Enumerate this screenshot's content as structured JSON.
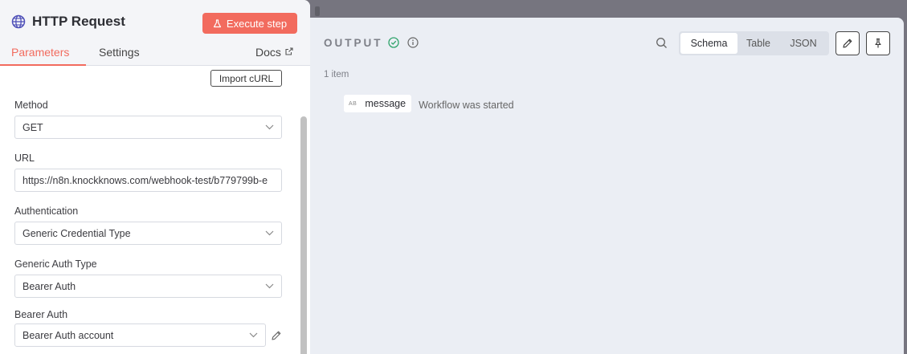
{
  "node": {
    "title": "HTTP Request",
    "execute_label": "Execute step",
    "tabs": {
      "parameters": "Parameters",
      "settings": "Settings",
      "docs": "Docs"
    }
  },
  "params": {
    "import_label": "Import cURL",
    "method": {
      "label": "Method",
      "value": "GET"
    },
    "url": {
      "label": "URL",
      "value": "https://n8n.knockknows.com/webhook-test/b779799b-e"
    },
    "authentication": {
      "label": "Authentication",
      "value": "Generic Credential Type"
    },
    "generic_auth_type": {
      "label": "Generic Auth Type",
      "value": "Bearer Auth"
    },
    "bearer_auth": {
      "label": "Bearer Auth",
      "value": "Bearer Auth account"
    }
  },
  "output": {
    "title": "OUTPUT",
    "views": {
      "schema": "Schema",
      "table": "Table",
      "json": "JSON"
    },
    "item_count": "1 item",
    "rows": [
      {
        "type": "AB",
        "key": "message",
        "value": "Workflow was started"
      }
    ]
  },
  "colors": {
    "accent": "#f26b5e",
    "success": "#2fa36b"
  }
}
